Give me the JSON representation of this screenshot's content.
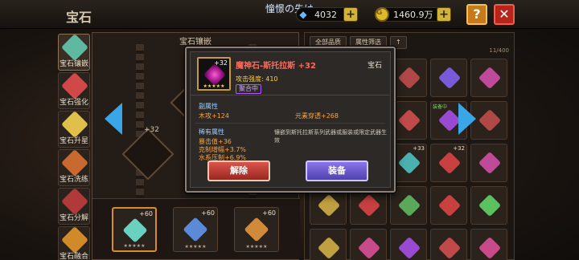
{
  "header": {
    "game_title": "憧憬の先は",
    "page_title": "宝石",
    "gems_amount": "4032",
    "gold_amount": "1460.9万",
    "help_label": "?",
    "close_label": "✕",
    "plus_label": "+"
  },
  "sidebar": {
    "items": [
      {
        "label": "宝石镶嵌",
        "color": "#5fb8a0",
        "active": true
      },
      {
        "label": "宝石强化",
        "color": "#d04848",
        "active": false
      },
      {
        "label": "宝石升星",
        "color": "#e0c04a",
        "active": false
      },
      {
        "label": "宝石洗练",
        "color": "#c86a30",
        "active": false
      },
      {
        "label": "宝石分解",
        "color": "#b03a3a",
        "active": false
      },
      {
        "label": "宝石融合",
        "color": "#d08a2a",
        "active": false
      }
    ]
  },
  "gem_panel": {
    "title": "宝石镶嵌",
    "socket_level": "+32",
    "slots": [
      {
        "level": "+60",
        "stars": "★★★★★",
        "color": "#6ad0c0",
        "selected": true
      },
      {
        "level": "+60",
        "stars": "★★★★★",
        "color": "#5a8ad8",
        "selected": false
      },
      {
        "level": "+60",
        "stars": "★★★★★",
        "color": "#d08a3a",
        "selected": false
      }
    ]
  },
  "inventory": {
    "filter_all": "全部品质",
    "filter_attr": "属性筛选",
    "sort_icon": "↑",
    "count": "11/400",
    "equipped_tag": "装备中",
    "cells": [
      {
        "level": "",
        "tag": "",
        "color": "#c04a9a"
      },
      {
        "level": "",
        "tag": "",
        "color": "#c8a03a"
      },
      {
        "level": "",
        "tag": "",
        "color": "#b04848"
      },
      {
        "level": "",
        "tag": "",
        "color": "#7a5ad8"
      },
      {
        "level": "",
        "tag": "",
        "color": "#c04a9a"
      },
      {
        "level": "",
        "tag": "装备中",
        "color": "#5aa85a"
      },
      {
        "level": "",
        "tag": "装备中",
        "color": "#d0a030"
      },
      {
        "level": "",
        "tag": "",
        "color": "#c04a4a"
      },
      {
        "level": "",
        "tag": "装备中",
        "color": "#9a4ad0"
      },
      {
        "level": "",
        "tag": "",
        "color": "#b04848"
      },
      {
        "level": "+32",
        "tag": "",
        "color": "#c85aa8"
      },
      {
        "level": "+32",
        "tag": "",
        "color": "#c84a6a"
      },
      {
        "level": "+33",
        "tag": "",
        "color": "#4ab0b0"
      },
      {
        "level": "+32",
        "tag": "",
        "color": "#c84040"
      },
      {
        "level": "",
        "tag": "",
        "color": "#c04a9a"
      },
      {
        "level": "+32",
        "tag": "",
        "color": "#c0a040"
      },
      {
        "level": "",
        "tag": "",
        "color": "#c84040"
      },
      {
        "level": "",
        "tag": "",
        "color": "#5aa85a"
      },
      {
        "level": "",
        "tag": "",
        "color": "#c84040"
      },
      {
        "level": "",
        "tag": "",
        "color": "#5ac060"
      },
      {
        "level": "",
        "tag": "",
        "color": "#c0a040"
      },
      {
        "level": "",
        "tag": "",
        "color": "#c84a8a"
      },
      {
        "level": "",
        "tag": "",
        "color": "#9a4ad0"
      },
      {
        "level": "",
        "tag": "",
        "color": "#c04a4a"
      },
      {
        "level": "",
        "tag": "",
        "color": "#c84a8a"
      }
    ]
  },
  "popup": {
    "item_level": "+32",
    "item_stars": "★★★★★",
    "item_name": "魔神石-斯托拉斯 +32",
    "item_type": "宝石",
    "main_stat": "攻击强度: 410",
    "badge": "聚合中",
    "secondary_title": "副属性",
    "secondary_left": "木攻+124",
    "secondary_right": "元素穿透+268",
    "rare_title": "稀有属性",
    "rare_desc": "镶嵌到斯托拉斯系列武器或服装或限定武器生效",
    "rare_lines": [
      "暴击值+36",
      "克制增幅+3.7%",
      "水系压制+6.9%"
    ],
    "release_label": "解除",
    "equip_label": "装备"
  }
}
